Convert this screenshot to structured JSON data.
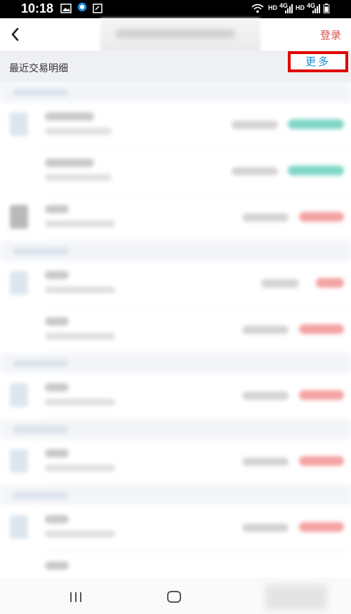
{
  "status_bar": {
    "time": "10:18",
    "hd1": "HD",
    "net1": "4G",
    "hd2": "HD",
    "net2": "4G"
  },
  "header": {
    "login_label": "登录"
  },
  "section": {
    "title": "最近交易明细",
    "more_label": "更多"
  },
  "colors": {
    "accent_blue": "#1b8fd0",
    "login_red": "#d9534f",
    "highlight_red": "#e00000",
    "section_bg": "#eef0f3"
  },
  "icons": {
    "back": "chevron-left-icon",
    "recent_apps": "recent-apps-icon",
    "home": "home-icon"
  }
}
